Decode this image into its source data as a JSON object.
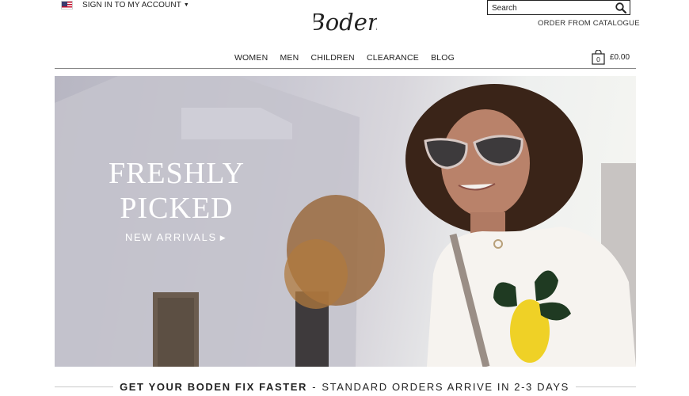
{
  "header": {
    "account_link": "SIGN IN TO MY ACCOUNT",
    "caret_icon": "caret-down-icon",
    "flag_icon": "us-flag-icon",
    "logo_text": "Boden",
    "search": {
      "placeholder": "Search",
      "icon": "search-icon"
    },
    "catalogue_link": "ORDER FROM CATALOGUE"
  },
  "nav": {
    "items": [
      {
        "label": "WOMEN"
      },
      {
        "label": "MEN"
      },
      {
        "label": "CHILDREN"
      },
      {
        "label": "CLEARANCE"
      },
      {
        "label": "BLOG"
      }
    ]
  },
  "basket": {
    "icon": "shopping-bag-icon",
    "count": "0",
    "total": "£0.00"
  },
  "hero": {
    "title_line1": "FRESHLY",
    "title_line2": "PICKED",
    "cta": "NEW ARRIVALS",
    "cta_icon": "arrow-right-icon"
  },
  "promo": {
    "bold_text": "GET YOUR BODEN FIX FASTER",
    "separator": "-",
    "text": "STANDARD ORDERS ARRIVE IN 2-3 DAYS"
  }
}
